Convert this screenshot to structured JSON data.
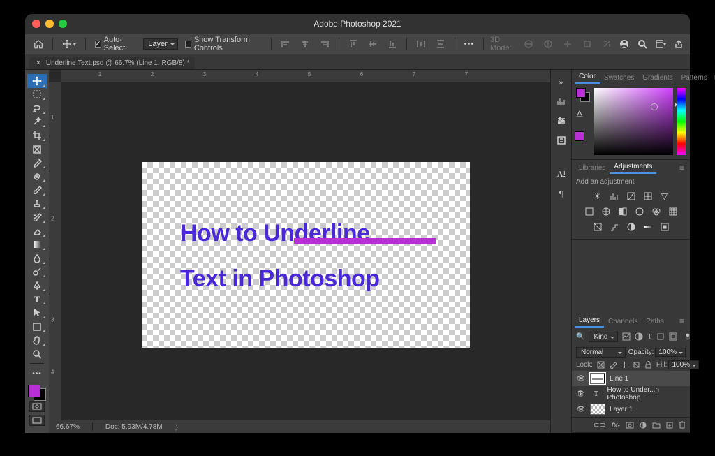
{
  "title": "Adobe Photoshop 2021",
  "options": {
    "auto_select_label": "Auto-Select:",
    "auto_select_target": "Layer",
    "show_transform_label": "Show Transform Controls",
    "mode3d_label": "3D Mode:"
  },
  "doctab": {
    "name": "Underline Text.psd @ 66.7% (Line 1, RGB/8) *"
  },
  "ruler_top": [
    "1",
    "2",
    "3",
    "4",
    "5",
    "6",
    "7"
  ],
  "ruler_left": [
    "1",
    "2",
    "3",
    "4"
  ],
  "canvas": {
    "line1": "How to Underline",
    "line2": "Text in Photoshop",
    "underline_color": "#b82fd6",
    "text_color": "#4a28d8"
  },
  "status": {
    "zoom": "66.67%",
    "doc": "Doc: 5.93M/4.78M"
  },
  "swatch_foreground": "#b82fd6",
  "panels": {
    "color": {
      "tabs": [
        "Color",
        "Swatches",
        "Gradients",
        "Patterns"
      ],
      "active": 0
    },
    "libs": {
      "tabs": [
        "Libraries",
        "Adjustments"
      ],
      "active": 1,
      "hint": "Add an adjustment"
    },
    "layers": {
      "tabs": [
        "Layers",
        "Channels",
        "Paths"
      ],
      "active": 0,
      "kind_label": "Kind",
      "blend_mode": "Normal",
      "opacity_label": "Opacity:",
      "opacity_value": "100%",
      "lock_label": "Lock:",
      "fill_label": "Fill:",
      "fill_value": "100%",
      "items": [
        {
          "name": "Line 1",
          "type": "shape",
          "visible": true,
          "selected": true
        },
        {
          "name": "How to Under...n Photoshop",
          "type": "text",
          "visible": true,
          "selected": false
        },
        {
          "name": "Layer 1",
          "type": "raster",
          "visible": true,
          "selected": false
        }
      ]
    }
  },
  "filter_placeholder": "Kind"
}
